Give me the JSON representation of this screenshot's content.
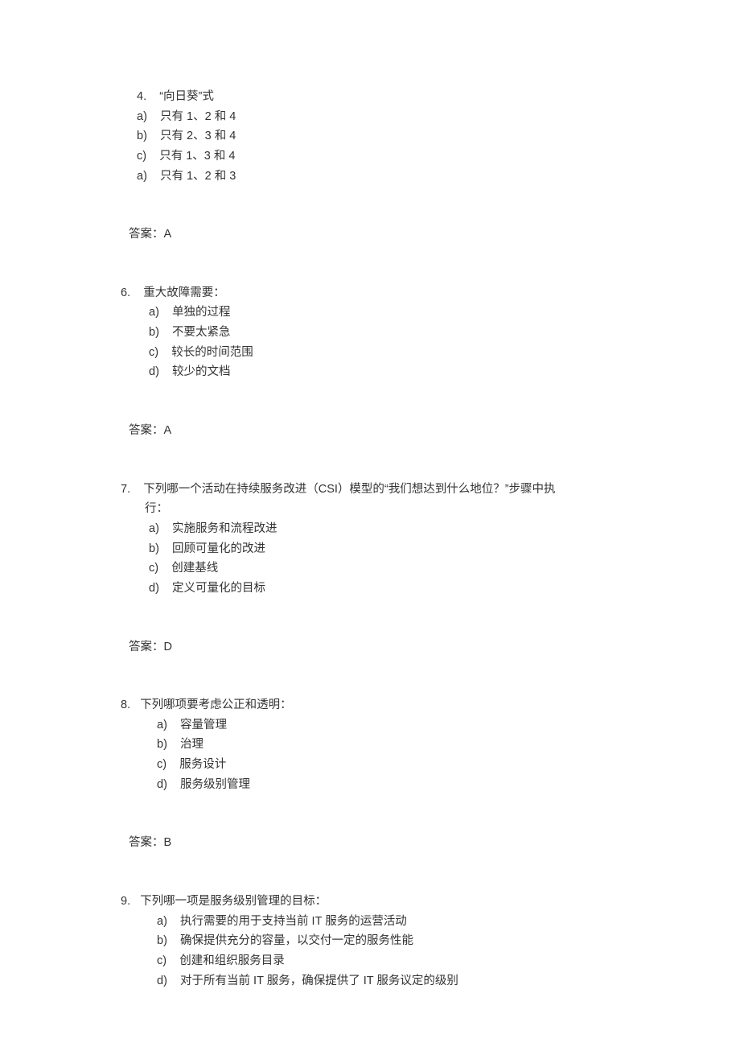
{
  "top_fragment": {
    "items": [
      {
        "marker": "4.",
        "text": "“向日葵”式"
      }
    ],
    "options": [
      {
        "marker": "a)",
        "text": "只有 1、2 和 4"
      },
      {
        "marker": "b)",
        "text": "只有 2、3 和 4"
      },
      {
        "marker": "c)",
        "text": "只有 1、3 和 4"
      },
      {
        "marker": "a)",
        "text": "只有 1、2 和 3"
      }
    ],
    "answer": "答案：A"
  },
  "questions": [
    {
      "number": "6.",
      "stem": "重大故障需要：",
      "options": [
        {
          "marker": "a)",
          "text": "单独的过程"
        },
        {
          "marker": "b)",
          "text": "不要太紧急"
        },
        {
          "marker": "c)",
          "text": "较长的时间范围"
        },
        {
          "marker": "d)",
          "text": "较少的文档"
        }
      ],
      "answer": "答案：A"
    },
    {
      "number": "7.",
      "stem": "下列哪一个活动在持续服务改进（CSI）模型的“我们想达到什么地位？”步骤中执",
      "stem_cont": "行：",
      "options": [
        {
          "marker": "a)",
          "text": "实施服务和流程改进"
        },
        {
          "marker": "b)",
          "text": "回顾可量化的改进"
        },
        {
          "marker": "c)",
          "text": "创建基线"
        },
        {
          "marker": "d)",
          "text": "定义可量化的目标"
        }
      ],
      "answer": "答案：D"
    },
    {
      "number": "8.",
      "stem": "下列哪项要考虑公正和透明：",
      "options": [
        {
          "marker": "a)",
          "text": "容量管理"
        },
        {
          "marker": "b)",
          "text": "治理"
        },
        {
          "marker": "c)",
          "text": "服务设计"
        },
        {
          "marker": "d)",
          "text": "服务级别管理"
        }
      ],
      "answer": "答案：B"
    },
    {
      "number": "9.",
      "stem": "下列哪一项是服务级别管理的目标：",
      "options": [
        {
          "marker": "a)",
          "text": "执行需要的用于支持当前 IT 服务的运营活动"
        },
        {
          "marker": "b)",
          "text": "确保提供充分的容量，以交付一定的服务性能"
        },
        {
          "marker": "c)",
          "text": "创建和组织服务目录"
        },
        {
          "marker": "d)",
          "text": "对于所有当前 IT 服务，确保提供了 IT 服务议定的级别"
        }
      ]
    }
  ]
}
